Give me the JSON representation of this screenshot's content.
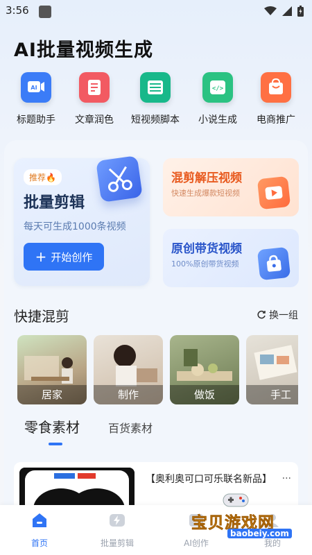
{
  "status": {
    "time": "3:56"
  },
  "header": {
    "title": "AI批量视频生成"
  },
  "tools": [
    {
      "label": "标题助手",
      "icon": "ai-title-icon",
      "color": "#3b7cf7",
      "glyph": "AI"
    },
    {
      "label": "文章润色",
      "icon": "document-icon",
      "color": "#f25a62",
      "glyph": "≡"
    },
    {
      "label": "短视频脚本",
      "icon": "script-icon",
      "color": "#18b88a",
      "glyph": "▤"
    },
    {
      "label": "小说生成",
      "icon": "code-icon",
      "color": "#2bc282",
      "glyph": "</>"
    },
    {
      "label": "电商推广",
      "icon": "shopping-bag-icon",
      "color": "#ff7043",
      "glyph": "⊔"
    }
  ],
  "batch_card": {
    "badge": "推荐🔥",
    "title": "批量剪辑",
    "subtitle": "每天可生成1000条视频",
    "button": "开始创作"
  },
  "mix_card": {
    "title": "混剪解压视频",
    "subtitle": "快速生成爆款短视频",
    "color": "#e85a1f"
  },
  "original_card": {
    "title": "原创带货视频",
    "subtitle": "100%原创带货视频",
    "color": "#2a55c9"
  },
  "quick_mix": {
    "title": "快捷混剪",
    "refresh": "换一组",
    "items": [
      {
        "label": "居家"
      },
      {
        "label": "制作"
      },
      {
        "label": "做饭"
      },
      {
        "label": "手工"
      }
    ]
  },
  "material_tabs": {
    "active": "零食素材",
    "other": "百货素材"
  },
  "product": {
    "title": "【奥利奥可口可乐联名新品】",
    "more": "..."
  },
  "nav": [
    {
      "label": "首页",
      "active": true
    },
    {
      "label": "批量剪辑",
      "active": false
    },
    {
      "label": "AI创作",
      "active": false
    },
    {
      "label": "我的",
      "active": false
    }
  ],
  "watermark": {
    "text": "宝贝游戏网",
    "url": "baobeiy.com"
  },
  "colors": {
    "accent": "#2f74f5",
    "nav_inactive": "#9aa1ad"
  }
}
